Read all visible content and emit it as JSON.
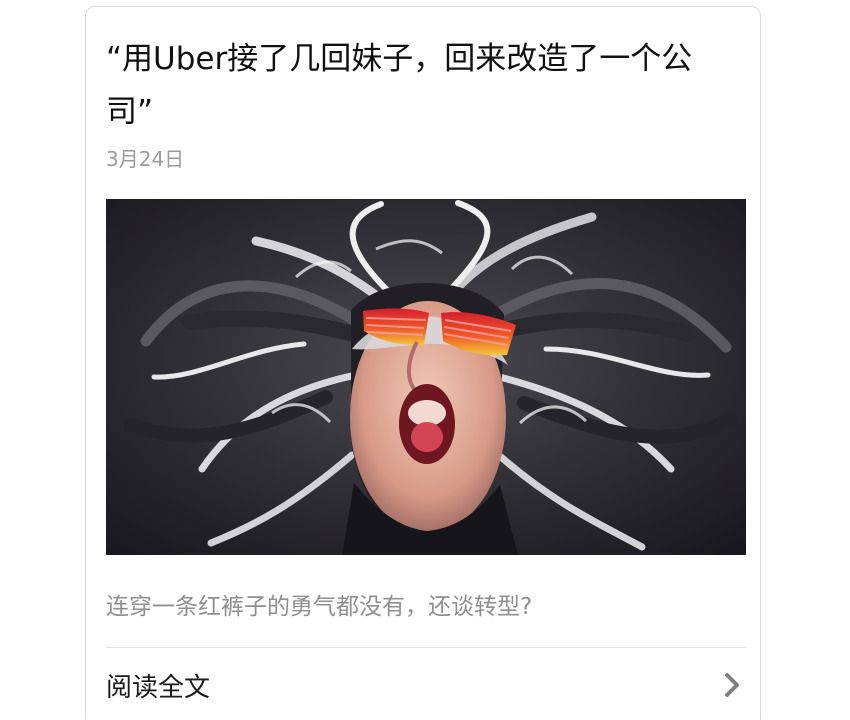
{
  "article": {
    "title": "“用Uber接了几回妹子，回来改造了一个公司”",
    "date": "3月24日",
    "digest": "连穿一条红裤子的勇气都没有，还谈转型?",
    "read_more_label": "阅读全文",
    "read_more_icon": "chevron-right-icon"
  },
  "colors": {
    "title": "#111111",
    "meta": "#9b9b9b",
    "digest": "#8f8f8f",
    "border": "#d9d9d9",
    "divider": "#e3e3e3"
  }
}
